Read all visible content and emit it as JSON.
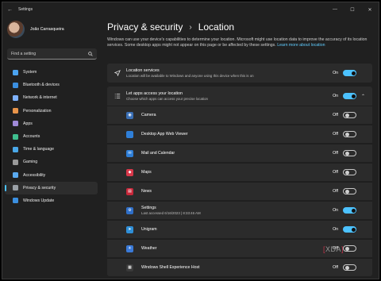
{
  "window": {
    "title": "Settings"
  },
  "user": {
    "name": "João Carrasqueira"
  },
  "search": {
    "placeholder": "Find a setting"
  },
  "sidebar": {
    "items": [
      {
        "label": "System",
        "icon": "system-icon",
        "color": "#4ba3f0"
      },
      {
        "label": "Bluetooth & devices",
        "icon": "bluetooth-icon",
        "color": "#3b8fe0"
      },
      {
        "label": "Network & internet",
        "icon": "wifi-icon",
        "color": "#7fb2ff"
      },
      {
        "label": "Personalization",
        "icon": "brush-icon",
        "color": "#e8944a"
      },
      {
        "label": "Apps",
        "icon": "apps-icon",
        "color": "#a08ad8"
      },
      {
        "label": "Accounts",
        "icon": "account-icon",
        "color": "#3fbf8f"
      },
      {
        "label": "Time & language",
        "icon": "globe-icon",
        "color": "#4aa8e8"
      },
      {
        "label": "Gaming",
        "icon": "gamepad-icon",
        "color": "#9a9a9a"
      },
      {
        "label": "Accessibility",
        "icon": "accessibility-icon",
        "color": "#5aaaf0"
      },
      {
        "label": "Privacy & security",
        "icon": "shield-icon",
        "color": "#9aa0a6"
      },
      {
        "label": "Windows Update",
        "icon": "update-icon",
        "color": "#3b8fe0"
      }
    ],
    "active_index": 9
  },
  "header": {
    "parent": "Privacy & security",
    "separator": "›",
    "current": "Location"
  },
  "description": {
    "text": "Windows can use your device's capabilities to determine your location. Microsoft might use location data to improve the accuracy of its location services. Some desktop apps might not appear on this page or be affected by these settings.",
    "link": "Learn more about location"
  },
  "location_services": {
    "title": "Location services",
    "subtitle": "Location will be available to Windows and anyone using this device when this is on",
    "state": "On",
    "on": true
  },
  "let_apps": {
    "title": "Let apps access your location",
    "subtitle": "Choose which apps can access your precise location",
    "state": "On",
    "on": true
  },
  "apps": [
    {
      "name": "Camera",
      "detail": "",
      "state": "Off",
      "on": false,
      "icon": "camera-icon",
      "color": "#3a6fb5",
      "glyph": "◉"
    },
    {
      "name": "Desktop App Web Viewer",
      "detail": "",
      "state": "Off",
      "on": false,
      "icon": "web-viewer-icon",
      "color": "#2f7fd8",
      "glyph": ""
    },
    {
      "name": "Mail and Calendar",
      "detail": "",
      "state": "Off",
      "on": false,
      "icon": "mail-icon",
      "color": "#2f7fd8",
      "glyph": "✉"
    },
    {
      "name": "Maps",
      "detail": "",
      "state": "Off",
      "on": false,
      "icon": "maps-icon",
      "color": "#d8384a",
      "glyph": "◆"
    },
    {
      "name": "News",
      "detail": "",
      "state": "Off",
      "on": false,
      "icon": "news-icon",
      "color": "#c8283a",
      "glyph": "▤"
    },
    {
      "name": "Settings",
      "detail": "Last accessed 6/16/2023 | 8:33:46 AM",
      "state": "On",
      "on": true,
      "icon": "settings-icon",
      "color": "#2f6fc8",
      "glyph": "⚙"
    },
    {
      "name": "Unigram",
      "detail": "",
      "state": "On",
      "on": true,
      "icon": "unigram-icon",
      "color": "#2f8fd8",
      "glyph": "➤"
    },
    {
      "name": "Weather",
      "detail": "",
      "state": "Off",
      "on": false,
      "icon": "weather-icon",
      "color": "#3a7ad8",
      "glyph": "☀"
    },
    {
      "name": "Windows Shell Experience Host",
      "detail": "",
      "state": "Off",
      "on": false,
      "icon": "shell-host-icon",
      "color": "#3a3a3a",
      "glyph": "▦"
    }
  ],
  "watermark": "XDA"
}
